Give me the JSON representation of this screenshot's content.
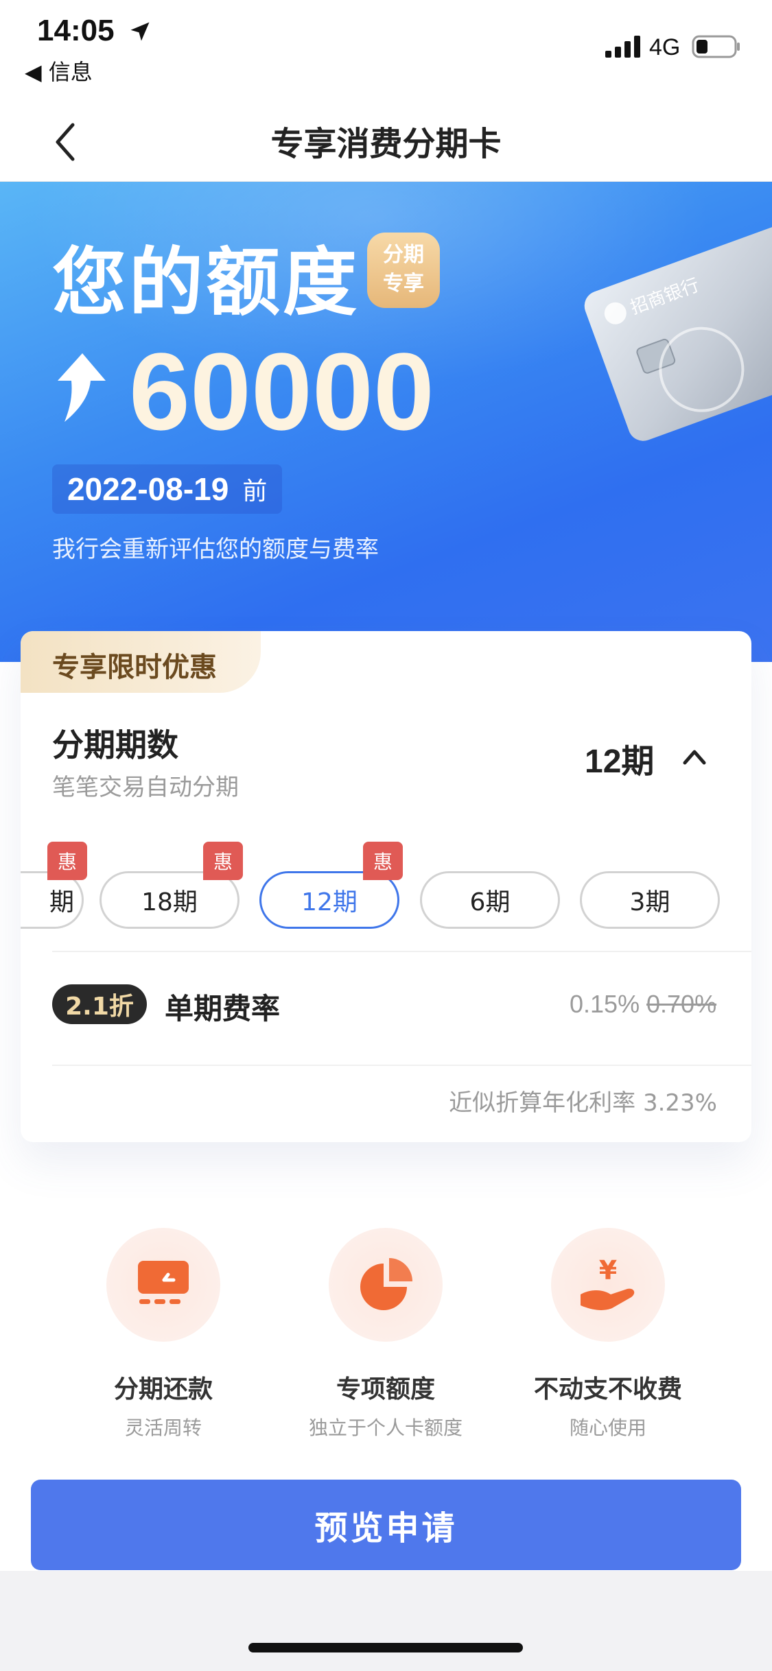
{
  "status_bar": {
    "time": "14:05",
    "back_app": "◀ 信息",
    "network": "4G"
  },
  "nav": {
    "title": "专享消费分期卡"
  },
  "hero": {
    "heading": "您的额度",
    "tag_line1": "分期",
    "tag_line2": "专享",
    "amount": "60000",
    "date": "2022-08-19",
    "date_suffix": "前",
    "note": "我行会重新评估您的额度与费率",
    "card_bank_text": "招商银行"
  },
  "panel": {
    "promo": "专享限时优惠",
    "installments_title": "分期期数",
    "installments_sub": "笔笔交易自动分期",
    "selected_period": "12期",
    "chips": [
      {
        "label": "期",
        "badge": "惠",
        "selected": false
      },
      {
        "label": "18期",
        "badge": "惠",
        "selected": false
      },
      {
        "label": "12期",
        "badge": "惠",
        "selected": true
      },
      {
        "label": "6期",
        "badge": "",
        "selected": false
      },
      {
        "label": "3期",
        "badge": "",
        "selected": false
      }
    ],
    "discount": "2.1折",
    "rate_label": "单期费率",
    "rate_now": "0.15%",
    "rate_old": "0.70%",
    "annual_rate": "近似折算年化利率 3.23%"
  },
  "features": [
    {
      "name": "分期还款",
      "desc": "灵活周转",
      "icon": "card-installment-icon"
    },
    {
      "name": "专项额度",
      "desc": "独立于个人卡额度",
      "icon": "pie-chart-icon"
    },
    {
      "name": "不动支不收费",
      "desc": "随心使用",
      "icon": "yen-hand-icon"
    }
  ],
  "apply_button": "预览申请",
  "colors": {
    "primary": "#4f78ec",
    "hero_blue": "#2f6ff0",
    "badge_red": "#e05a55",
    "icon_orange": "#f06a35"
  }
}
